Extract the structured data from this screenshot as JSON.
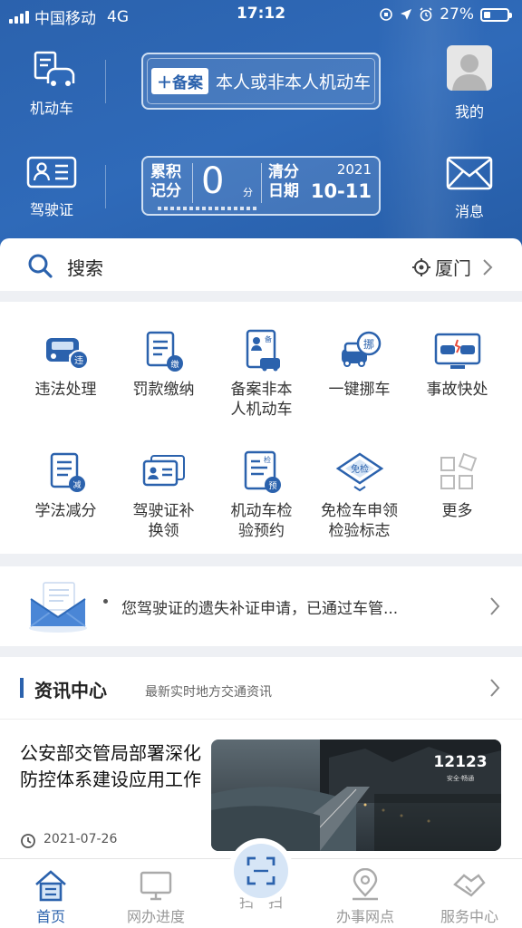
{
  "status": {
    "carrier": "中国移动",
    "network": "4G",
    "time": "17:12",
    "battery": "27%"
  },
  "header": {
    "vehicle_label": "机动车",
    "license_label": "驾驶证",
    "me_label": "我的",
    "message_label": "消息",
    "register_tag": "备案",
    "register_text": "本人或非本人机动车",
    "score_title_1": "累积",
    "score_title_2": "记分",
    "score_value": "0",
    "score_unit": "分",
    "clear_title_1": "清分",
    "clear_title_2": "日期",
    "clear_year": "2021",
    "clear_date": "10-11"
  },
  "search": {
    "placeholder": "搜索",
    "city": "厦门"
  },
  "services": [
    {
      "label": "违法处理",
      "icon": "car-violation-icon"
    },
    {
      "label": "罚款缴纳",
      "icon": "fine-payment-icon"
    },
    {
      "label": "备案非本人机动车",
      "icon": "register-vehicle-icon"
    },
    {
      "label": "一键挪车",
      "icon": "move-car-icon"
    },
    {
      "label": "事故快处",
      "icon": "accident-icon"
    },
    {
      "label": "学法减分",
      "icon": "study-law-icon"
    },
    {
      "label": "驾驶证补换领",
      "icon": "license-renew-icon"
    },
    {
      "label": "机动车检验预约",
      "icon": "inspection-booking-icon"
    },
    {
      "label": "免检车申领检验标志",
      "icon": "exempt-label-icon"
    },
    {
      "label": "更多",
      "icon": "more-icon"
    }
  ],
  "notice": {
    "text": "您驾驶证的遗失补证申请，已通过车管..."
  },
  "news": {
    "title": "资讯中心",
    "subtitle": "最新实时地方交通资讯",
    "headline": "公安部交管局部署深化防控体系建设应用工作",
    "date": "2021-07-26",
    "image_text": "12123",
    "image_subtext": "安全·畅通"
  },
  "tabs": [
    "首页",
    "网办进度",
    "扫一扫",
    "办事网点",
    "服务中心"
  ],
  "colors": {
    "brand": "#2b62ad",
    "accent_red": "#e84b3c"
  }
}
